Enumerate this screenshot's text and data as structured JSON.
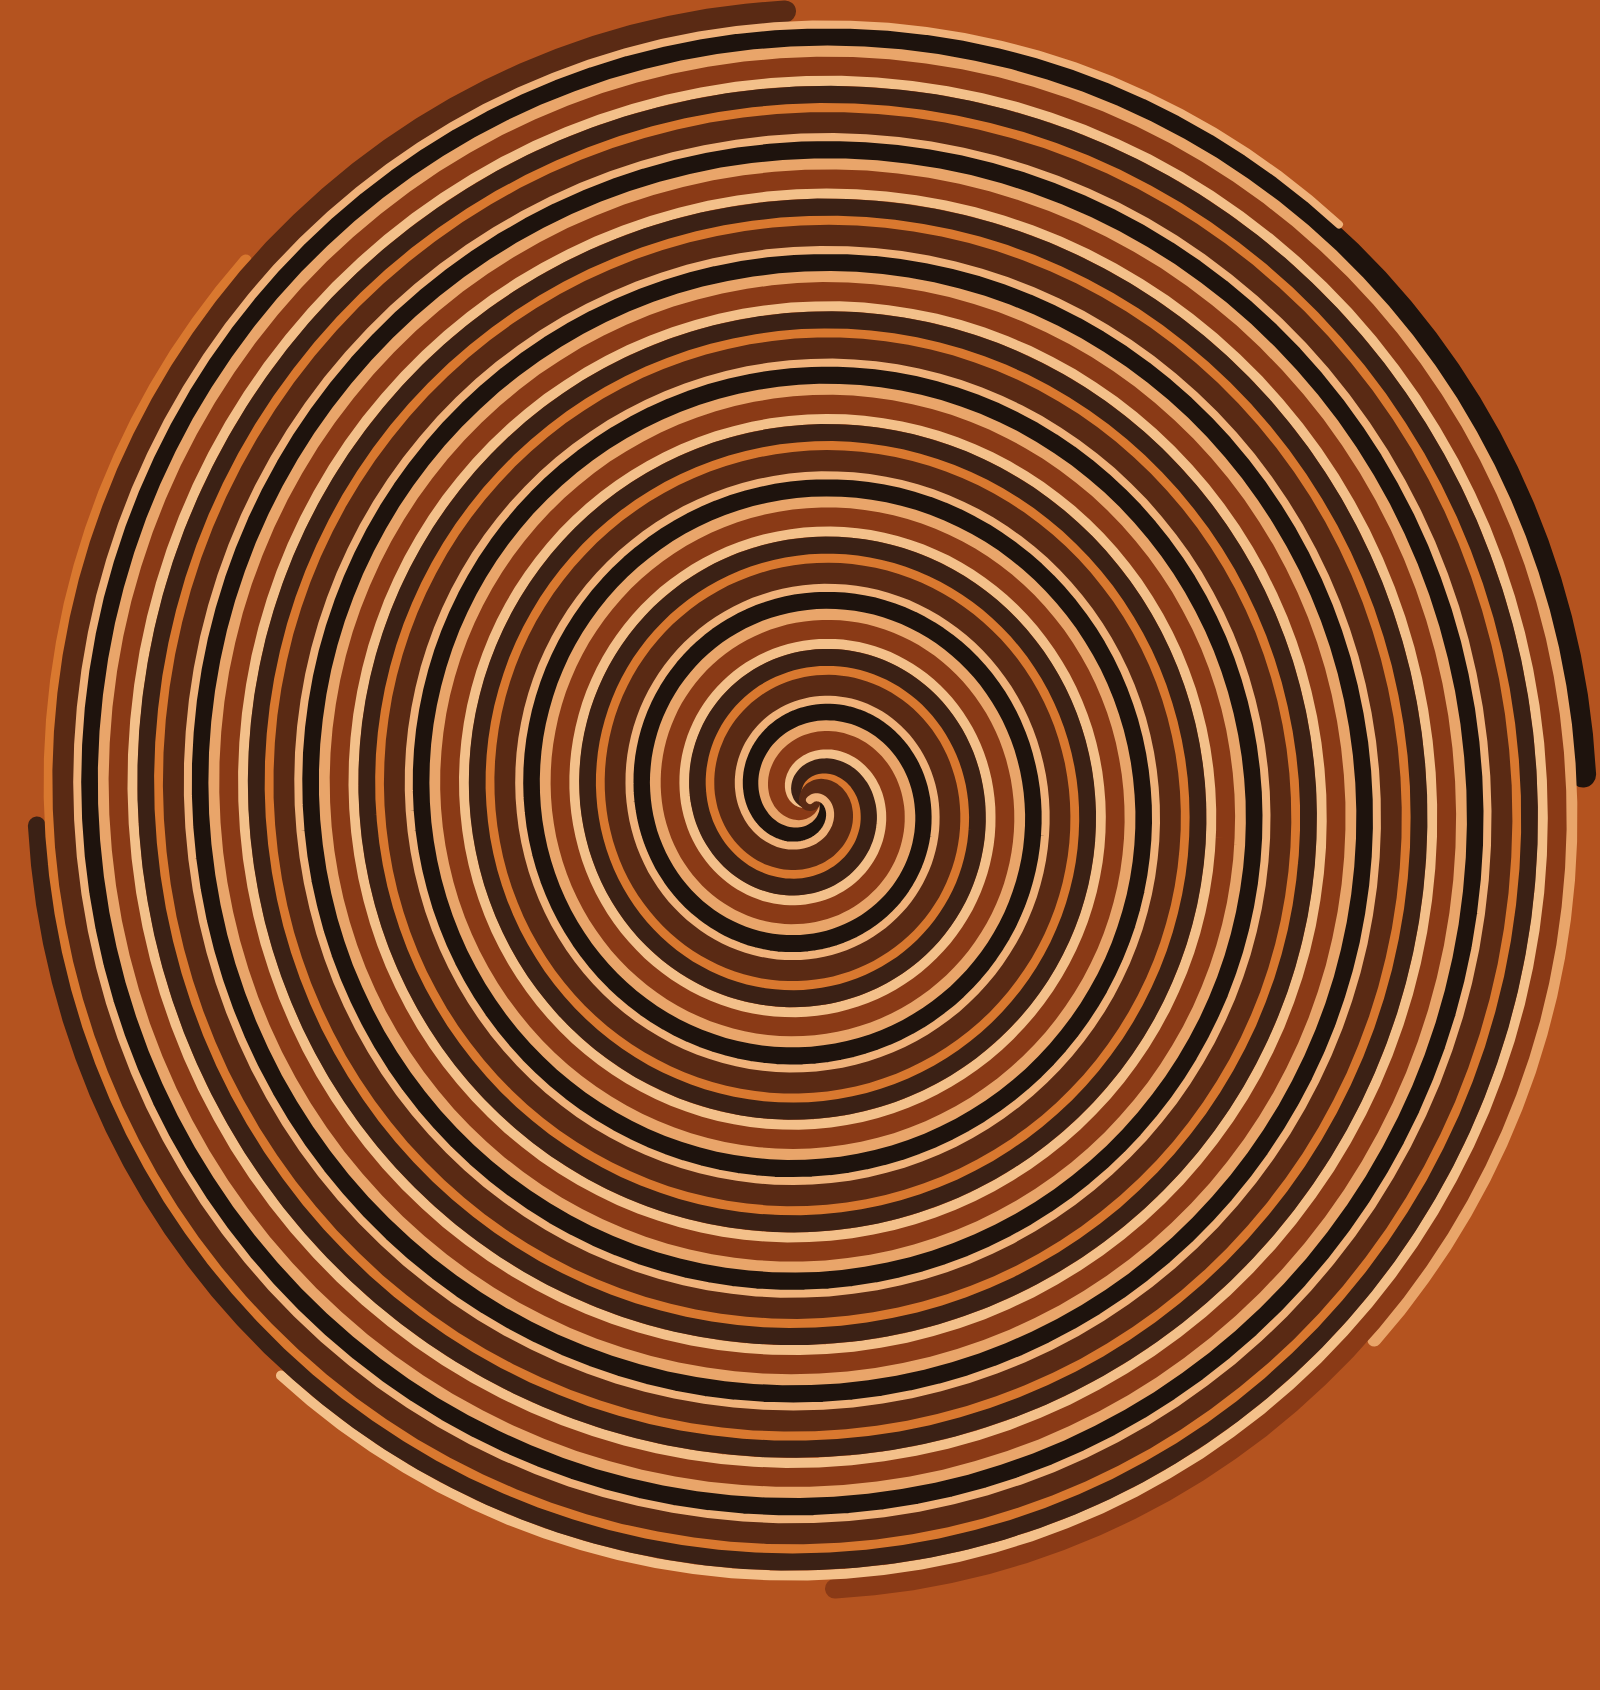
{
  "artwork": {
    "kind": "swirl"
  }
}
